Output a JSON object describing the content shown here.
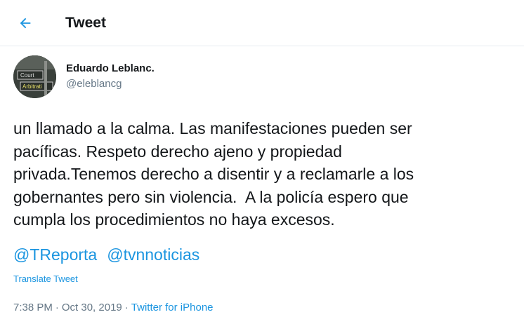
{
  "colors": {
    "accent": "#1b95e0",
    "text": "#14171a",
    "secondary": "#657786",
    "divider": "#e6ecf0"
  },
  "header": {
    "back_icon": "arrow-left-icon",
    "title": "Tweet"
  },
  "author": {
    "avatar_lines": [
      "Court",
      "Arbitrati"
    ],
    "name": "Eduardo Leblanc.",
    "handle": "@eleblancg"
  },
  "tweet": {
    "text": "un llamado a la calma. Las manifestaciones pueden ser\npacíficas. Respeto derecho ajeno y propiedad\nprivada.Tenemos derecho a disentir y a reclamarle a los\ngobernantes pero sin violencia.  A la policía espero que\ncumpla los procedimientos no haya excesos.",
    "mentions": [
      "@TReporta",
      "@tvnnoticias"
    ],
    "translate_label": "Translate Tweet"
  },
  "meta": {
    "time": "7:38 PM",
    "separator": "·",
    "date": "Oct 30, 2019",
    "source": "Twitter for iPhone"
  }
}
